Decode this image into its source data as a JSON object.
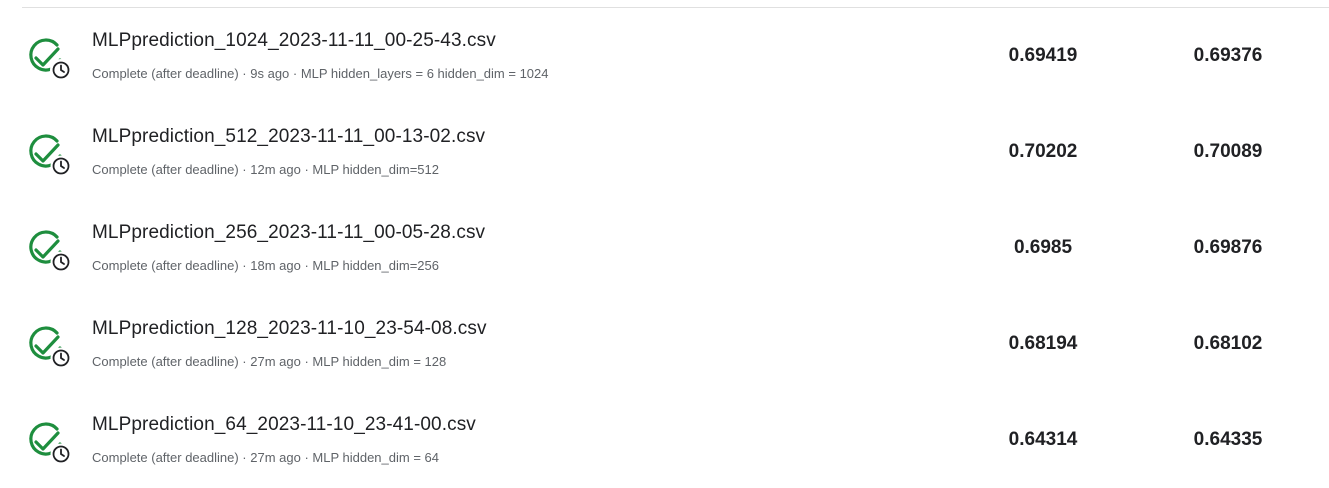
{
  "submissions": [
    {
      "file_name": "MLPprediction_1024_2023-11-11_00-25-43.csv",
      "meta": "Complete (after deadline) · 9s ago · MLP hidden_layers = 6 hidden_dim = 1024",
      "private_score": "0.69419",
      "public_score": "0.69376"
    },
    {
      "file_name": "MLPprediction_512_2023-11-11_00-13-02.csv",
      "meta": "Complete (after deadline) · 12m ago · MLP hidden_dim=512",
      "private_score": "0.70202",
      "public_score": "0.70089"
    },
    {
      "file_name": "MLPprediction_256_2023-11-11_00-05-28.csv",
      "meta": "Complete (after deadline) · 18m ago · MLP hidden_dim=256",
      "private_score": "0.6985",
      "public_score": "0.69876"
    },
    {
      "file_name": "MLPprediction_128_2023-11-10_23-54-08.csv",
      "meta": "Complete (after deadline) · 27m ago · MLP hidden_dim = 128",
      "private_score": "0.68194",
      "public_score": "0.68102"
    },
    {
      "file_name": "MLPprediction_64_2023-11-10_23-41-00.csv",
      "meta": "Complete (after deadline) · 27m ago · MLP hidden_dim = 64",
      "private_score": "0.64314",
      "public_score": "0.64335"
    }
  ],
  "icons": {
    "status": "check-with-clock-icon",
    "check_color": "#1e8e3e",
    "clock_color": "#202124"
  }
}
